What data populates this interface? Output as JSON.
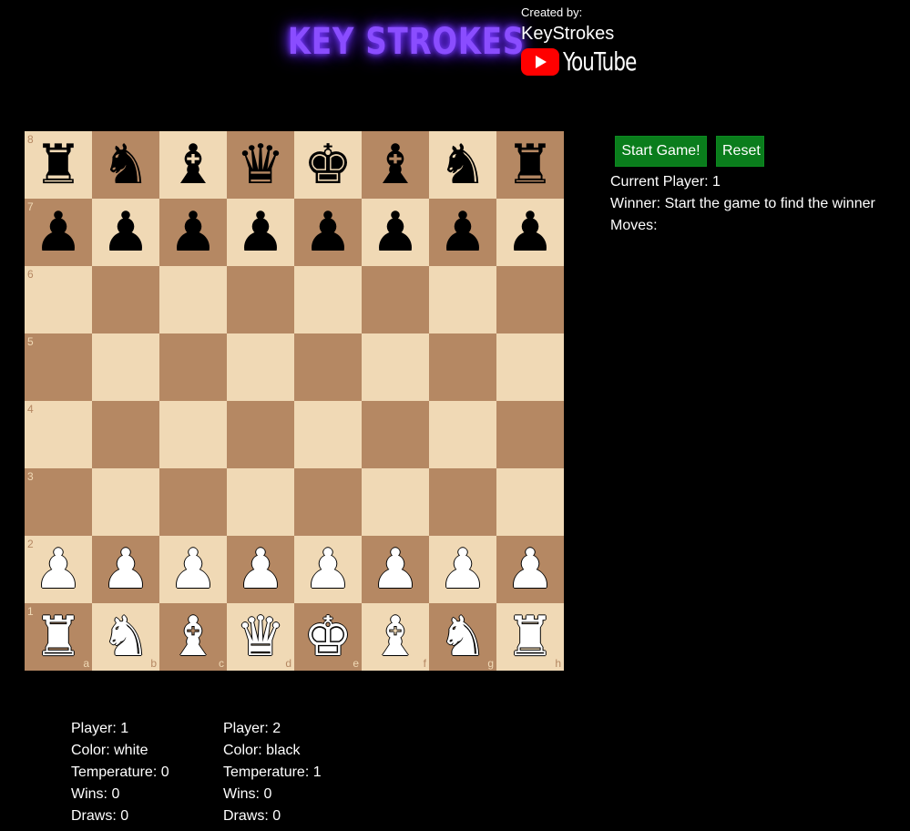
{
  "header": {
    "logo_text": "KEY STROKES",
    "created_by_label": "Created by:",
    "creator_name": "KeyStrokes",
    "platform_label": "YouTube",
    "accent_color": "#8a4dff",
    "youtube_red": "#ff0000"
  },
  "controls": {
    "start_label": "Start Game!",
    "reset_label": "Reset",
    "button_color": "#0a7d1c"
  },
  "status": {
    "current_player": "Current Player: 1",
    "winner": "Winner: Start the game to find the winner",
    "moves": "Moves:"
  },
  "board": {
    "light_color": "#f0d9b5",
    "dark_color": "#b58863",
    "files": [
      "a",
      "b",
      "c",
      "d",
      "e",
      "f",
      "g",
      "h"
    ],
    "ranks": [
      "8",
      "7",
      "6",
      "5",
      "4",
      "3",
      "2",
      "1"
    ],
    "rows": [
      [
        "r",
        "n",
        "b",
        "q",
        "k",
        "b",
        "n",
        "r"
      ],
      [
        "p",
        "p",
        "p",
        "p",
        "p",
        "p",
        "p",
        "p"
      ],
      [
        "",
        "",
        "",
        "",
        "",
        "",
        "",
        ""
      ],
      [
        "",
        "",
        "",
        "",
        "",
        "",
        "",
        ""
      ],
      [
        "",
        "",
        "",
        "",
        "",
        "",
        "",
        ""
      ],
      [
        "",
        "",
        "",
        "",
        "",
        "",
        "",
        ""
      ],
      [
        "P",
        "P",
        "P",
        "P",
        "P",
        "P",
        "P",
        "P"
      ],
      [
        "R",
        "N",
        "B",
        "Q",
        "K",
        "B",
        "N",
        "R"
      ]
    ]
  },
  "players": [
    {
      "player": "Player: 1",
      "color": "Color: white",
      "temperature": "Temperature: 0",
      "wins": "Wins: 0",
      "draws": "Draws: 0"
    },
    {
      "player": "Player: 2",
      "color": "Color: black",
      "temperature": "Temperature: 1",
      "wins": "Wins: 0",
      "draws": "Draws: 0"
    }
  ]
}
